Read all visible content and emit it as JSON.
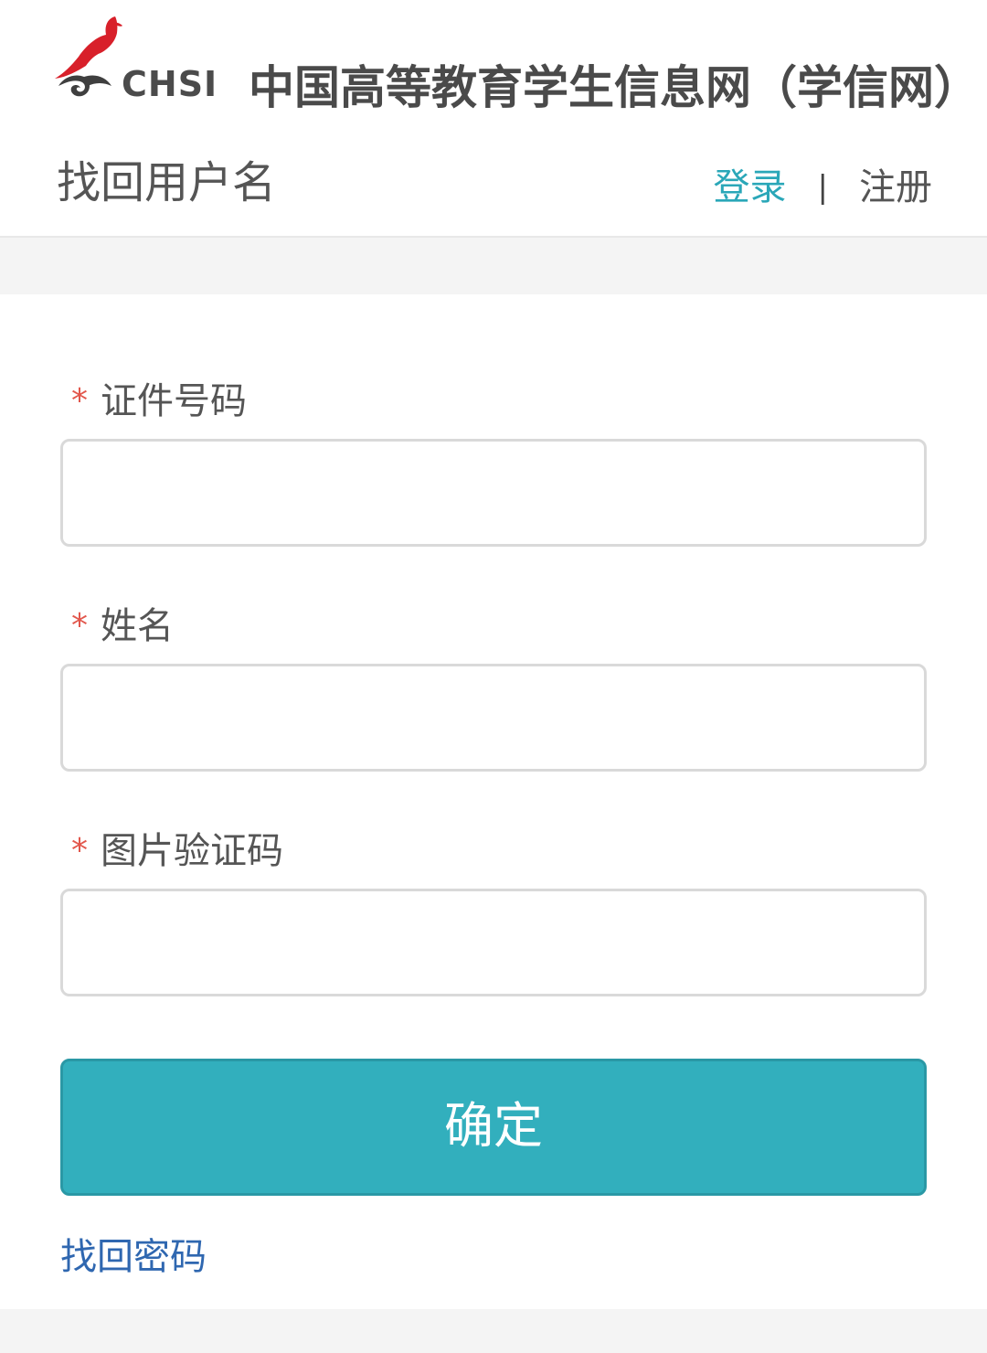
{
  "header": {
    "logo_text": "CHSI",
    "site_title": "中国高等教育学生信息网（学信网）",
    "page_title": "找回用户名",
    "nav": {
      "login": "登录",
      "separator": "|",
      "register": "注册"
    }
  },
  "form": {
    "required_mark": "*",
    "fields": [
      {
        "label": "证件号码",
        "value": "",
        "placeholder": ""
      },
      {
        "label": "姓名",
        "value": "",
        "placeholder": ""
      },
      {
        "label": "图片验证码",
        "value": "",
        "placeholder": ""
      }
    ],
    "submit_label": "确定",
    "forgot_password_link": "找回密码"
  },
  "colors": {
    "accent": "#32afbd",
    "link_login": "#2aa7b8",
    "link_forgot": "#2f67b0",
    "required": "#e2574c",
    "logo_red": "#d8202a"
  },
  "icons": {
    "logo": "chsi-logo-icon"
  }
}
